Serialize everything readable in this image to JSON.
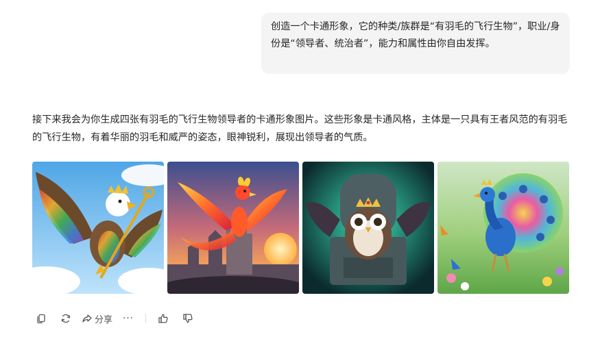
{
  "user_message": "创造一个卡通形象，它的种类/族群是“有羽毛的飞行生物”，职业/身份是“领导者、统治者”，能力和属性由你自由发挥。",
  "answer_text": "接下来我会为你生成四张有羽毛的飞行生物领导者的卡通形象图片。这些形象是卡通风格，主体是一只具有王者风范的有羽毛的飞行生物，有着华丽的羽毛和威严的姿态，眼神锐利，展现出领导者的气质。",
  "images": [
    {
      "subject": "crowned eagle with scepter"
    },
    {
      "subject": "phoenix over castle at sunset"
    },
    {
      "subject": "crowned owl on stone throne"
    },
    {
      "subject": "crowned peacock in flower meadow"
    }
  ],
  "actions": {
    "share_label": "分享",
    "more_label": "···"
  },
  "colors": {
    "bubble_bg": "#f4f4f5",
    "text": "#262626",
    "icon": "#555555"
  }
}
